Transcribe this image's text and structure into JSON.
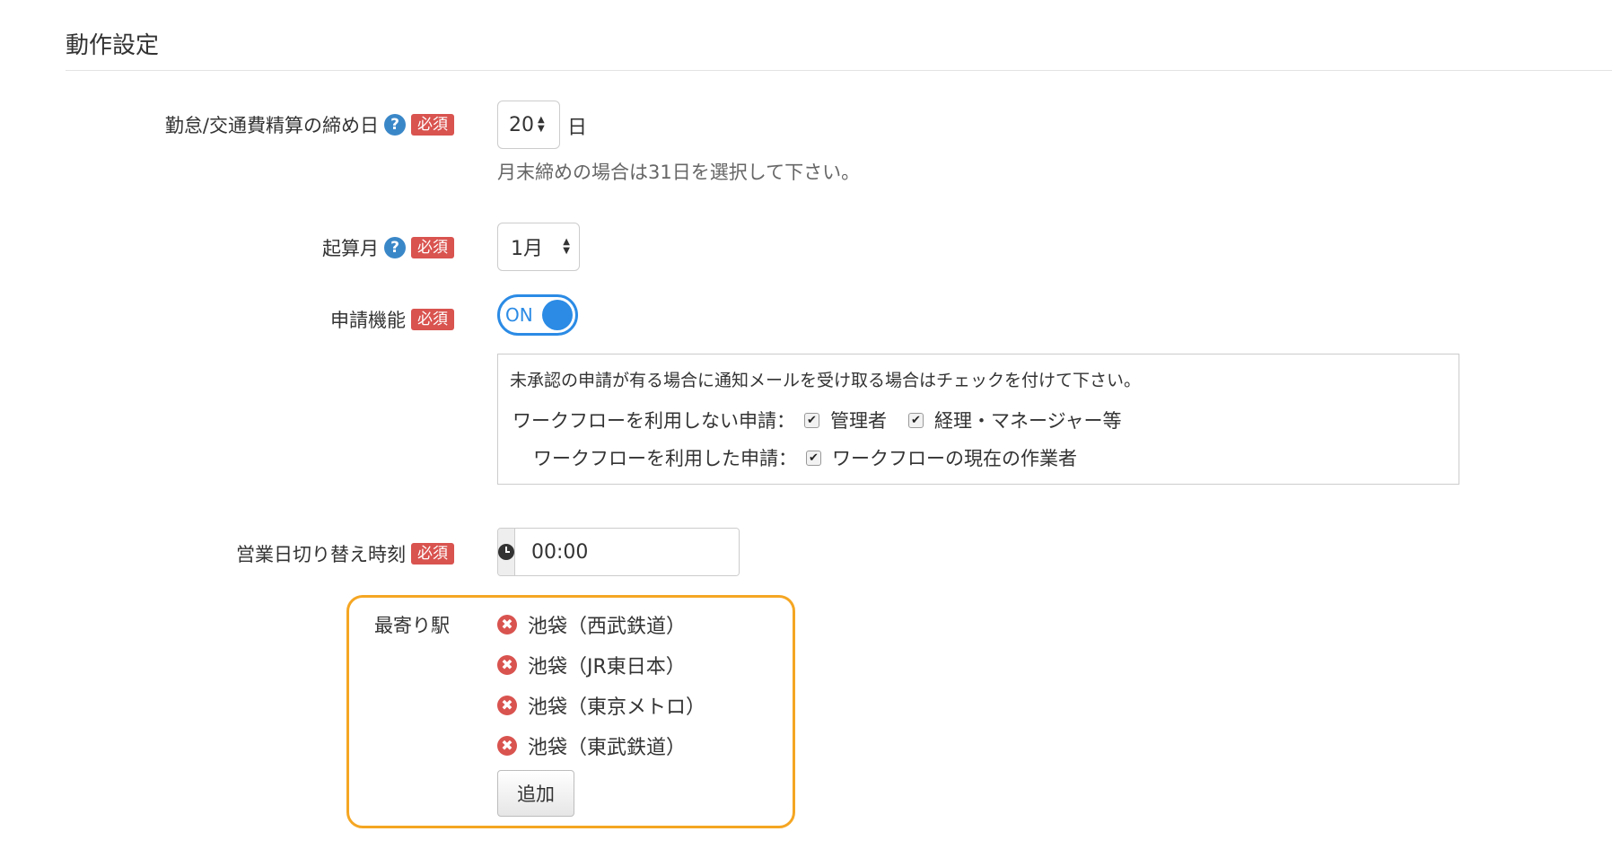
{
  "section_title": "動作設定",
  "required_badge": "必須",
  "help_glyph": "?",
  "closing_day": {
    "label": "勤怠/交通費精算の締め日",
    "value": "20",
    "unit": "日",
    "hint": "月末締めの場合は31日を選択して下さい。"
  },
  "start_month": {
    "label": "起算月",
    "value": "1月"
  },
  "application": {
    "label": "申請機能",
    "toggle_text": "ON",
    "toggle_on": true
  },
  "notification": {
    "description": "未承認の申請が有る場合に通知メールを受け取る場合はチェックを付けて下さい。",
    "row1_label": "ワークフローを利用しない申請：",
    "row1_options": [
      "管理者",
      "経理・マネージャー等"
    ],
    "row2_label": "ワークフローを利用した申請：",
    "row2_options": [
      "ワークフローの現在の作業者"
    ]
  },
  "business_day": {
    "label": "営業日切り替え時刻",
    "value": "00:00"
  },
  "nearest_station": {
    "label": "最寄り駅",
    "stations": [
      "池袋（西武鉄道）",
      "池袋（JR東日本）",
      "池袋（東京メトロ）",
      "池袋（東武鉄道）"
    ],
    "add_button": "追加"
  },
  "colors": {
    "required_badge": "#d9534f",
    "help_icon": "#3a87c8",
    "toggle": "#2b8be5",
    "highlight_border": "#f5a623"
  },
  "icons": {
    "help": "question-circle-icon",
    "clock": "clock-icon",
    "remove": "remove-circle-icon",
    "checkbox": "checkbox-checked-icon",
    "spinner": "spinner-arrows-icon"
  }
}
